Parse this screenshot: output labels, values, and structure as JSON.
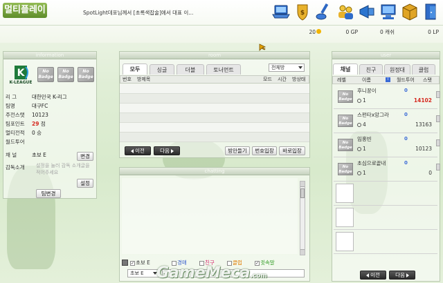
{
  "app": {
    "title": "멀티플레이"
  },
  "notice": "SpotLight데포님께서 [초록색잡술]에서 대표 이...",
  "topbar": {
    "icons": [
      {
        "name": "laptop-icon",
        "color": "#2f6cc9"
      },
      {
        "name": "shield-icon",
        "color": "#e3a21a"
      },
      {
        "name": "brush-icon",
        "color": "#2e68c4"
      },
      {
        "name": "people-icon",
        "color": "#e8b92a"
      },
      {
        "name": "megaphone-icon",
        "color": "#2b75cf"
      },
      {
        "name": "computer-icon",
        "color": "#2f6cc9"
      },
      {
        "name": "box-icon",
        "color": "#d49a1f"
      },
      {
        "name": "exit-icon",
        "color": "#2f6cc9"
      }
    ],
    "stats": {
      "coins": "20",
      "gp": "0 GP",
      "cash": "0 캐쉬",
      "lp": "0 LP"
    }
  },
  "info": {
    "header": "information",
    "league_logo_text": "K-LEAGUE",
    "badge_text": "No Badge",
    "rows": [
      {
        "label": "리      그",
        "value": "대한민국 K-리그"
      },
      {
        "label": "팀명",
        "value": "대구FC"
      },
      {
        "label": "주전스탯",
        "value": "10123"
      },
      {
        "label": "팀포인트",
        "value": "29",
        "suffix": "점"
      },
      {
        "label": "멀티전적",
        "value": "0 승"
      },
      {
        "label": "월드투어",
        "value": ""
      },
      {
        "label": "채      널",
        "value": "초보 E"
      }
    ],
    "change_label": "변경",
    "intro_label": "감독소개",
    "intro_text": "설정을 눌러 감독 소개글을 적어주세요",
    "settings_label": "설정",
    "team_change_label": "팀변경"
  },
  "room": {
    "header": "room",
    "tabs": [
      "모두",
      "싱글",
      "더블",
      "토너먼트"
    ],
    "filter": "전체방",
    "columns": [
      "번호",
      "방제목",
      "모드",
      "시간",
      "방상태"
    ],
    "prev_label": "이전",
    "next_label": "다음",
    "buttons": [
      "방만들기",
      "번호입장",
      "바로입장"
    ]
  },
  "chat": {
    "header": "chatting",
    "filters": [
      {
        "label": "초보 E",
        "checked": true,
        "color": "#333333"
      },
      {
        "label": "경매",
        "checked": false,
        "color": "#3a5fcd"
      },
      {
        "label": "친구",
        "checked": false,
        "color": "#d6246c"
      },
      {
        "label": "클럽",
        "checked": false,
        "color": "#e07b00"
      },
      {
        "label": "귓속말",
        "checked": true,
        "color": "#3aa02d"
      }
    ],
    "channel_select": "초보 E"
  },
  "user": {
    "header": "user",
    "tabs": [
      "채널",
      "친구",
      "원정대",
      "클럽"
    ],
    "columns": [
      "레벨",
      "이름",
      "월드투어",
      "스탯"
    ],
    "badge_text": "No Badge",
    "list": [
      {
        "name": "후니꿍이",
        "level": "1",
        "worldtour": "0",
        "stat": "14102",
        "stat_color": "#d6281e"
      },
      {
        "name": "스펀타x앙그라",
        "level": "4",
        "worldtour": "0",
        "stat": "13163",
        "stat_color": "#222222"
      },
      {
        "name": "임홍빈",
        "level": "1",
        "worldtour": "0",
        "stat": "10123",
        "stat_color": "#222222"
      },
      {
        "name": "초심으로끝내",
        "level": "1",
        "worldtour": "0",
        "stat": "0",
        "stat_color": "#222222"
      }
    ],
    "prev_label": "이전",
    "next_label": "다음"
  },
  "watermark": "GameMeca",
  "watermark_suffix": ".com"
}
